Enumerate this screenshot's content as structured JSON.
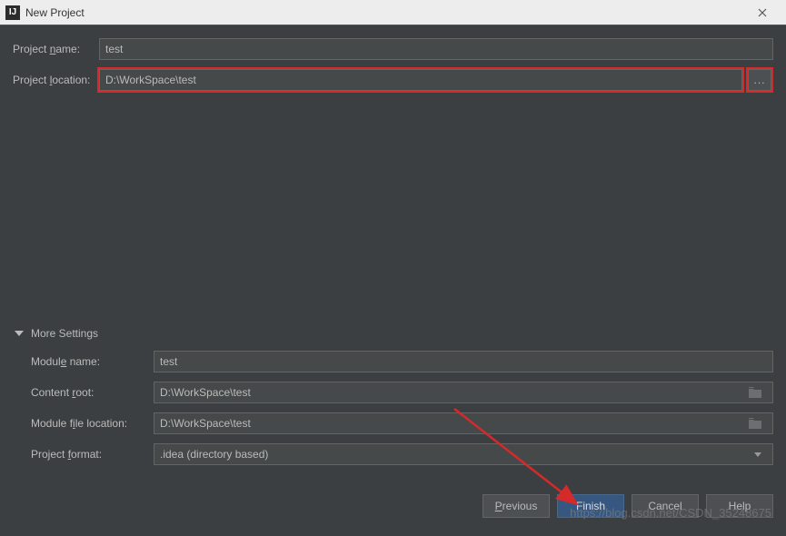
{
  "titlebar": {
    "app_icon_text": "IJ",
    "title": "New Project"
  },
  "fields": {
    "project_name_label": "Project name:",
    "project_name_value": "test",
    "project_location_label": "Project location:",
    "project_location_value": "D:\\WorkSpace\\test",
    "browse_label": "..."
  },
  "more": {
    "header": "More Settings",
    "module_name_label": "Module name:",
    "module_name_value": "test",
    "content_root_label": "Content root:",
    "content_root_value": "D:\\WorkSpace\\test",
    "module_file_location_label": "Module file location:",
    "module_file_location_value": "D:\\WorkSpace\\test",
    "project_format_label": "Project format:",
    "project_format_value": ".idea (directory based)"
  },
  "buttons": {
    "previous": "Previous",
    "finish": "Finish",
    "cancel": "Cancel",
    "help": "Help"
  },
  "watermark": "https://blog.csdn.net/CSDN_35248675"
}
